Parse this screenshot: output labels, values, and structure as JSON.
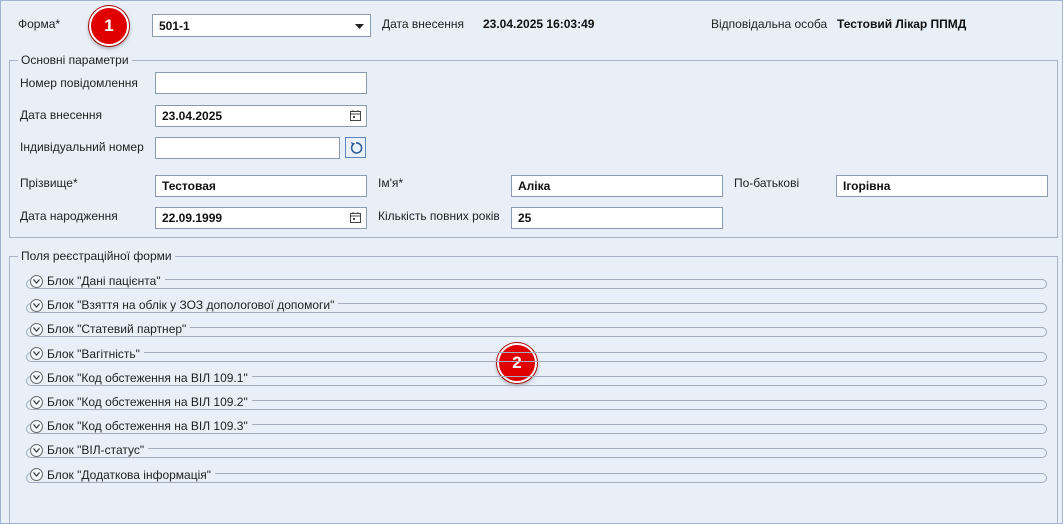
{
  "header": {
    "form_label": "Форма*",
    "form_value": "501-1",
    "entry_date_label": "Дата внесення",
    "entry_date_value": "23.04.2025 16:03:49",
    "responsible_label": "Відповідальна особа",
    "responsible_value": "Тестовий Лікар ППМД"
  },
  "badges": {
    "one": "1",
    "two": "2"
  },
  "main_params": {
    "legend": "Основні параметри",
    "message_number_label": "Номер повідомлення",
    "message_number_value": "",
    "entry_date_label": "Дата внесення",
    "entry_date_value": "23.04.2025",
    "individual_number_label": "Індивідуальний номер",
    "individual_number_value": "",
    "surname_label": "Прізвище*",
    "surname_value": "Тестовая",
    "name_label": "Ім'я*",
    "name_value": "Аліка",
    "patronymic_label": "По-батькові",
    "patronymic_value": "Ігорівна",
    "birth_date_label": "Дата народження",
    "birth_date_value": "22.09.1999",
    "full_years_label": "Кількість повних років",
    "full_years_value": "25"
  },
  "registration": {
    "legend": "Поля реєстраційної форми",
    "blocks": [
      {
        "label": "Блок \"Дані пацієнта\""
      },
      {
        "label": "Блок \"Взяття на облік у ЗОЗ допологової допомоги\""
      },
      {
        "label": "Блок \"Статевий партнер\""
      },
      {
        "label": "Блок \"Вагітність\""
      },
      {
        "label": "Блок \"Код обстеження на ВІЛ 109.1\""
      },
      {
        "label": "Блок \"Код обстеження на ВІЛ 109.2\""
      },
      {
        "label": "Блок \"Код обстеження на ВІЛ 109.3\""
      },
      {
        "label": "Блок \"ВІЛ-статус\""
      },
      {
        "label": "Блок \"Додаткова інформація\""
      }
    ]
  },
  "colors": {
    "badge": "#e00000",
    "background": "#e9eff7",
    "border": "#8a9bb0"
  }
}
